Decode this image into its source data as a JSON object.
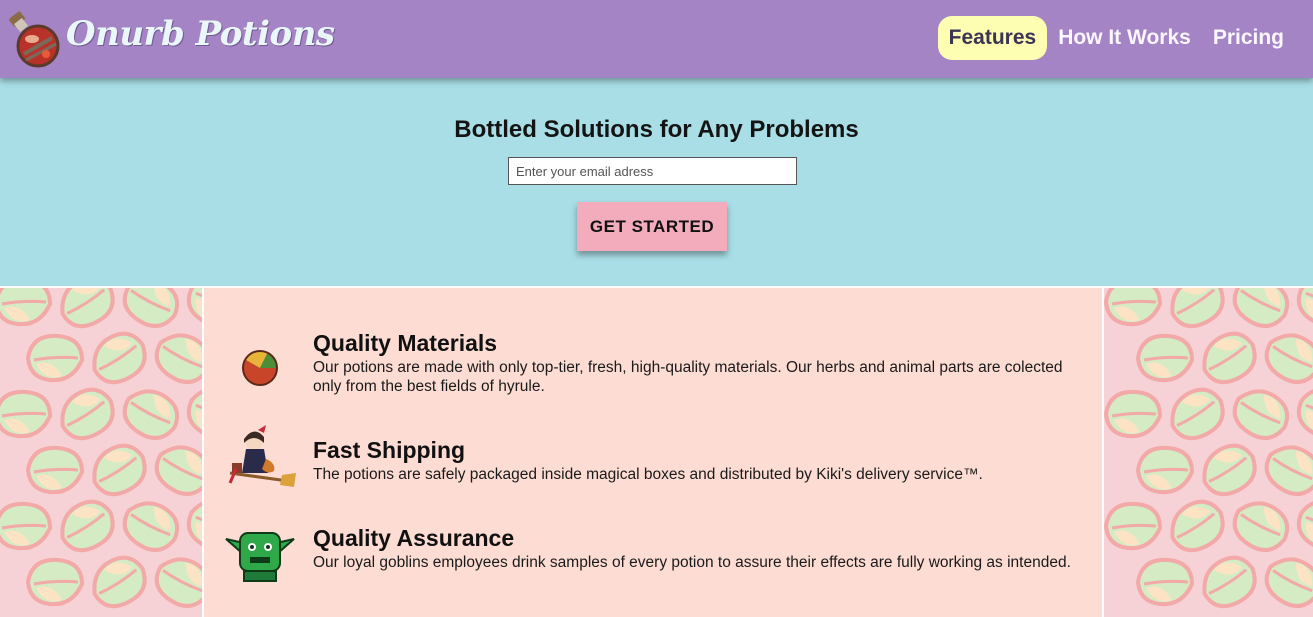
{
  "header": {
    "brand": "Onurb Potions",
    "logo_icon": "potion-bottle-icon",
    "colors": {
      "background": "#a484c5",
      "active_nav": "#fefeb3"
    },
    "nav": [
      {
        "label": "Features",
        "active": true
      },
      {
        "label": "How It Works",
        "active": false
      },
      {
        "label": "Pricing",
        "active": false
      }
    ]
  },
  "hero": {
    "title": "Bottled Solutions for Any Problems",
    "email_placeholder": "Enter your email adress",
    "cta_label": "GET STARTED",
    "colors": {
      "background": "#a9dee6",
      "button": "#f3acbc"
    }
  },
  "features": [
    {
      "icon": "orb-icon",
      "title": "Quality Materials",
      "text": "Our potions are made with only top-tier, fresh, high-quality materials. Our herbs and animal parts are colected only from the best fields of hyrule."
    },
    {
      "icon": "witch-on-broom-icon",
      "title": "Fast Shipping",
      "text": "The potions are safely packaged inside magical boxes and distributed by Kiki's delivery service™."
    },
    {
      "icon": "goblin-icon",
      "title": "Quality Assurance",
      "text": "Our loyal goblins employees drink samples of every potion to assure their effects are fully working as intended."
    }
  ]
}
